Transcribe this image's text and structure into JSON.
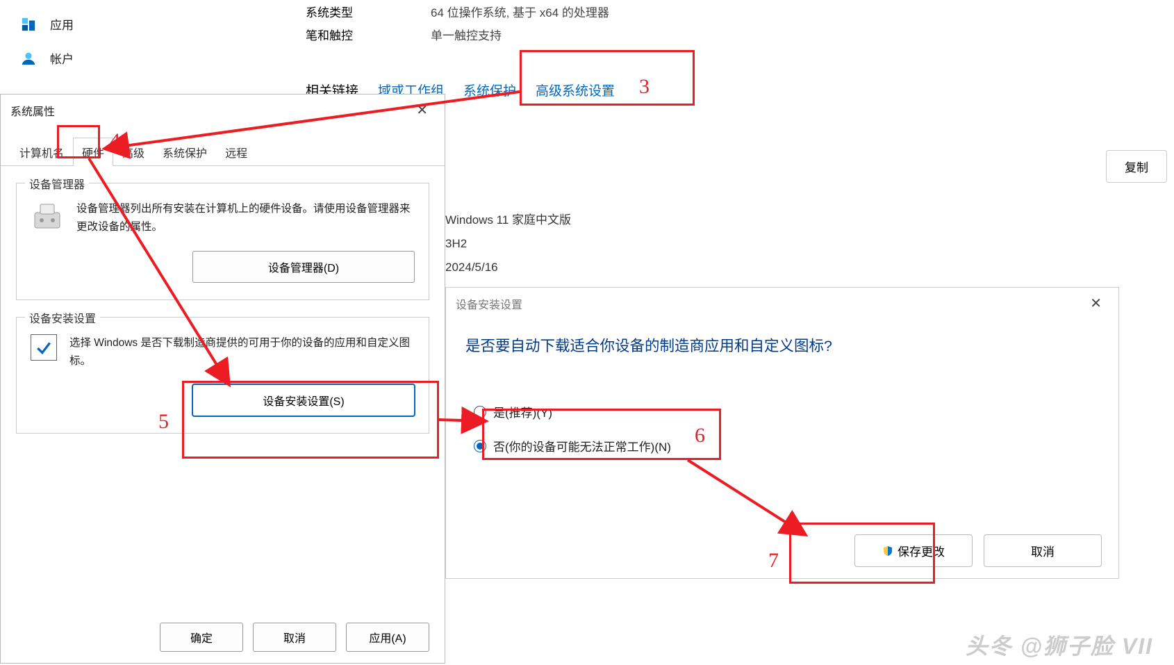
{
  "sidebar": {
    "items": [
      {
        "label": "应用"
      },
      {
        "label": "帐户"
      }
    ]
  },
  "details": {
    "rows": [
      {
        "k": "系统类型",
        "v": "64 位操作系统, 基于 x64 的处理器"
      },
      {
        "k": "笔和触控",
        "v": "单一触控支持"
      }
    ],
    "related_label": "相关链接",
    "links": [
      "域或工作组",
      "系统保护",
      "高级系统设置"
    ],
    "copy": "复制"
  },
  "wininfo": {
    "line1": "Windows 11 家庭中文版",
    "line2": "3H2",
    "line3": "2024/5/16"
  },
  "sysprop": {
    "title": "系统属性",
    "tabs": [
      "计算机名",
      "硬件",
      "高级",
      "系统保护",
      "远程"
    ],
    "g1_title": "设备管理器",
    "g1_text": "设备管理器列出所有安装在计算机上的硬件设备。请使用设备管理器来更改设备的属性。",
    "g1_btn": "设备管理器(D)",
    "g2_title": "设备安装设置",
    "g2_text": "选择 Windows 是否下载制造商提供的可用于你的设备的应用和自定义图标。",
    "g2_btn": "设备安装设置(S)",
    "ok": "确定",
    "cancel": "取消",
    "apply": "应用(A)"
  },
  "install": {
    "title": "设备安装设置",
    "question": "是否要自动下载适合你设备的制造商应用和自定义图标?",
    "opt1": "是(推荐)(Y)",
    "opt2": "否(你的设备可能无法正常工作)(N)",
    "save": "保存更改",
    "cancel": "取消"
  },
  "anno": {
    "n3": "3",
    "n4": "4",
    "n5": "5",
    "n6": "6",
    "n7": "7"
  },
  "watermark": "头冬 @狮子脸 VII"
}
